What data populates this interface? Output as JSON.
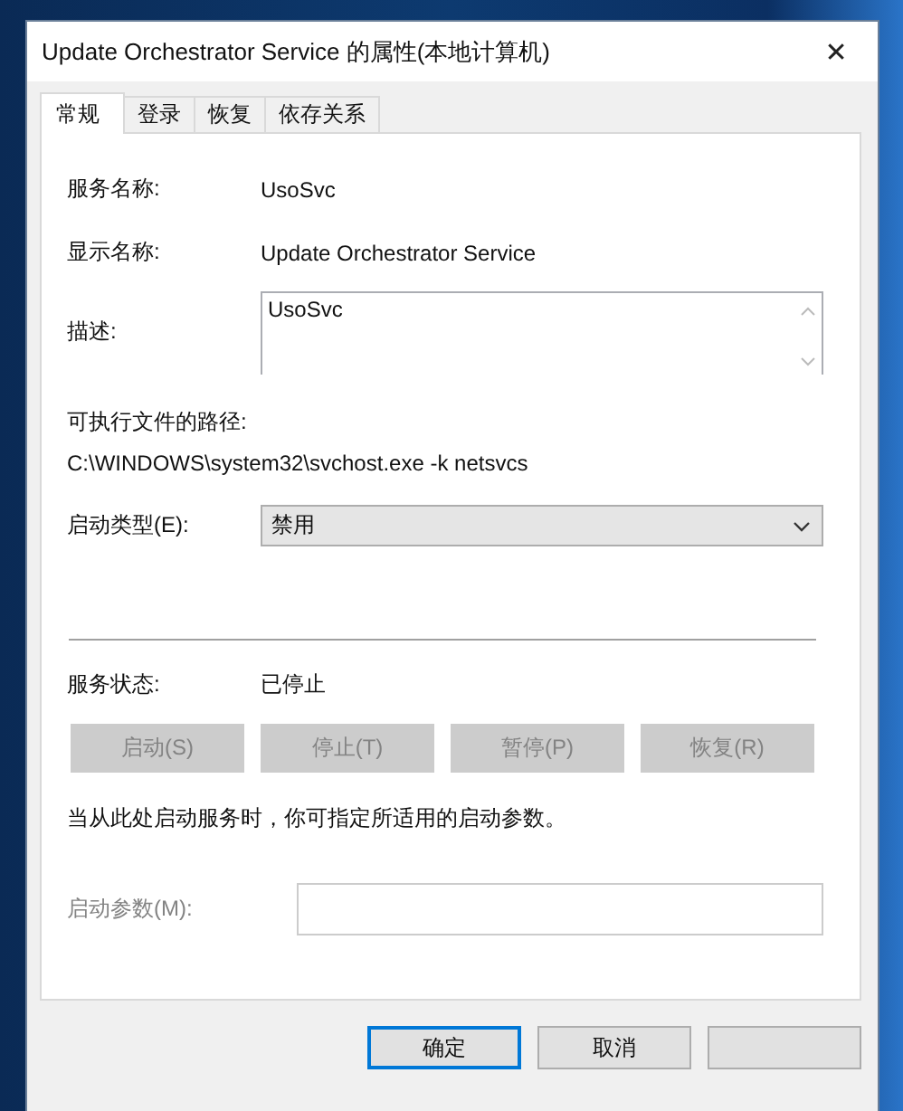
{
  "window": {
    "title": "Update Orchestrator Service 的属性(本地计算机)",
    "close": "✕"
  },
  "tabs": [
    {
      "label": "常规",
      "selected": true
    },
    {
      "label": "登录",
      "selected": false
    },
    {
      "label": "恢复",
      "selected": false
    },
    {
      "label": "依存关系",
      "selected": false
    }
  ],
  "service_name": {
    "label": "服务名称:",
    "value": "UsoSvc"
  },
  "display_name": {
    "label": "显示名称:",
    "value": "Update Orchestrator Service"
  },
  "description": {
    "label": "描述:",
    "value": "UsoSvc"
  },
  "executable_path": {
    "label": "可执行文件的路径:",
    "value": "C:\\WINDOWS\\system32\\svchost.exe -k netsvcs"
  },
  "startup_type": {
    "label": "启动类型(E):",
    "value": "禁用"
  },
  "service_status": {
    "label": "服务状态:",
    "value": "已停止"
  },
  "service_buttons": [
    {
      "label": "启动(S)",
      "disabled": true
    },
    {
      "label": "停止(T)",
      "disabled": true
    },
    {
      "label": "暂停(P)",
      "disabled": true
    },
    {
      "label": "恢复(R)",
      "disabled": true
    }
  ],
  "hint": "当从此处启动服务时，你可指定所适用的启动参数。",
  "start_parameters": {
    "label": "启动参数(M):",
    "disabled": true
  },
  "dialog_buttons": [
    {
      "label": "确定",
      "default": true
    },
    {
      "label": "取消",
      "default": false
    }
  ]
}
